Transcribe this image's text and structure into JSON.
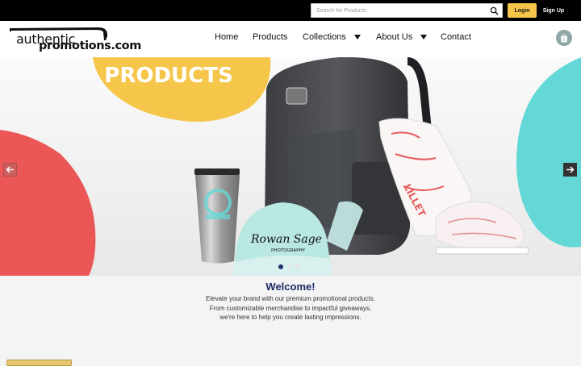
{
  "header": {
    "search": {
      "placeholder": "Search for Products",
      "icon": "search-icon"
    },
    "login_label": "Login",
    "signup_label": "Sign Up"
  },
  "brand": {
    "line1": "authentic",
    "line2": "promotions.com"
  },
  "nav": {
    "home": "Home",
    "products": "Products",
    "collections": "Collections",
    "about": "About Us",
    "contact": "Contact",
    "cart_icon": "shopping-bag-icon"
  },
  "hero": {
    "banner_title": "PRODUCTS",
    "cap_text_1": "Rowan Sage",
    "cap_text_2": "PHOTOGRAPHY",
    "shoe_text": "LILLET",
    "slides": 3,
    "active_slide": 1
  },
  "welcome": {
    "title": "Welcome!",
    "line1": "Elevate your brand with our premium promotional products.",
    "line2": "From customizable merchandise to impactful giveaways,",
    "line3": "we're here to help you create lasting impressions."
  },
  "colors": {
    "accent_yellow": "#f6c64b",
    "accent_red": "#eb5656",
    "accent_teal": "#63d8d6",
    "navy": "#1c2a66"
  }
}
